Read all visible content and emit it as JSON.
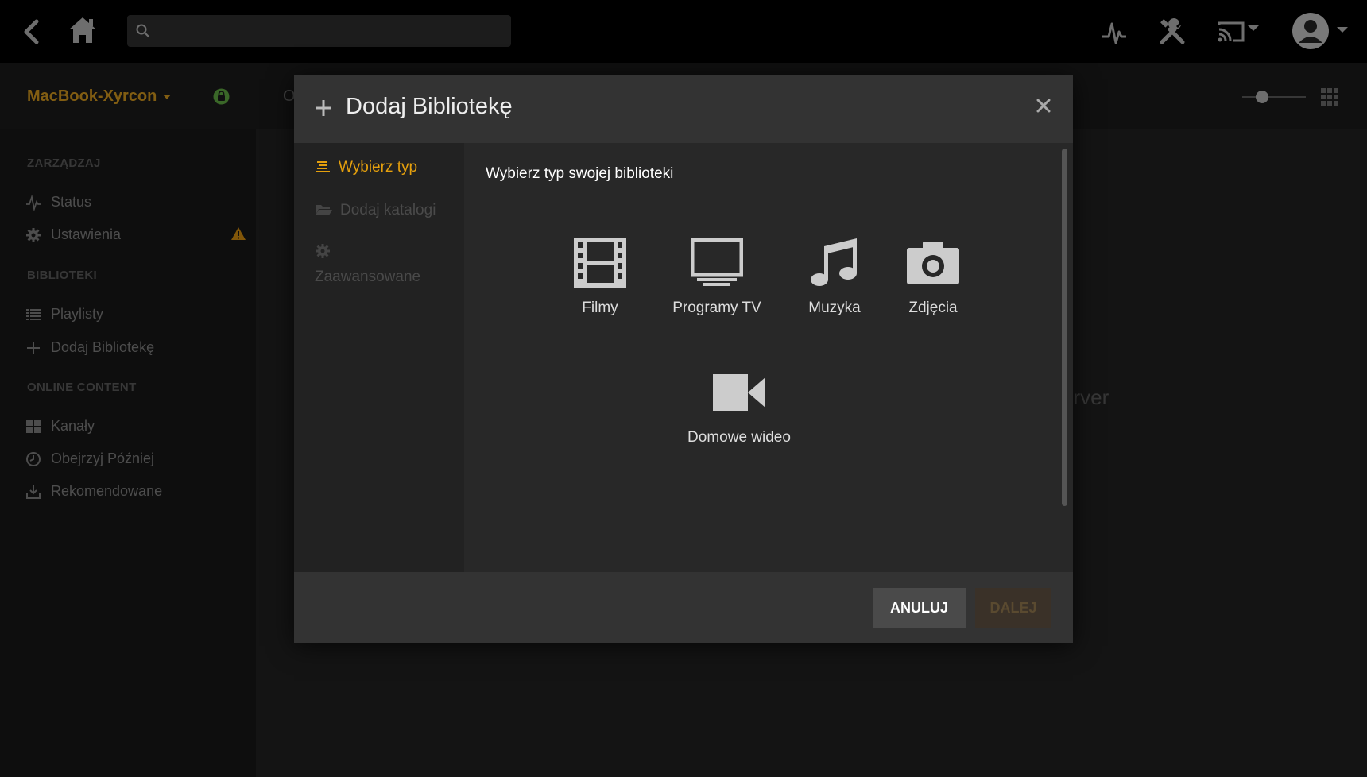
{
  "topbar": {
    "search_placeholder": ""
  },
  "subbar": {
    "server_name": "MacBook-Xyrcon",
    "tab_partial": "O"
  },
  "sidebar": {
    "sections": [
      {
        "title": "ZARZĄDZAJ",
        "items": [
          {
            "label": "Status",
            "icon": "activity-icon"
          },
          {
            "label": "Ustawienia",
            "icon": "gear-icon",
            "warning": true
          }
        ]
      },
      {
        "title": "BIBLIOTEKI",
        "items": [
          {
            "label": "Playlisty",
            "icon": "list-icon"
          },
          {
            "label": "Dodaj Bibliotekę",
            "icon": "plus-icon"
          }
        ]
      },
      {
        "title": "ONLINE CONTENT",
        "items": [
          {
            "label": "Kanały",
            "icon": "grid-icon"
          },
          {
            "label": "Obejrzyj Później",
            "icon": "clock-icon"
          },
          {
            "label": "Rekomendowane",
            "icon": "download-icon"
          }
        ]
      }
    ]
  },
  "background_text": "erver",
  "modal": {
    "title": "Dodaj Bibliotekę",
    "nav": [
      {
        "label": "Wybierz typ",
        "state": "active"
      },
      {
        "label": "Dodaj katalogi",
        "state": "disabled"
      },
      {
        "label": "Zaawansowane",
        "state": "disabled"
      }
    ],
    "heading": "Wybierz typ swojej biblioteki",
    "types": [
      {
        "label": "Filmy",
        "icon": "film-icon"
      },
      {
        "label": "Programy TV",
        "icon": "tv-icon"
      },
      {
        "label": "Muzyka",
        "icon": "music-icon"
      },
      {
        "label": "Zdjęcia",
        "icon": "camera-icon"
      },
      {
        "label": "Domowe wideo",
        "icon": "video-camera-icon"
      }
    ],
    "buttons": {
      "cancel": "ANULUJ",
      "next": "DALEJ"
    }
  },
  "colors": {
    "accent": "#e5a00d",
    "server_name": "#c78f1d",
    "warning": "#c7850f",
    "lock": "#5a9e3e"
  }
}
